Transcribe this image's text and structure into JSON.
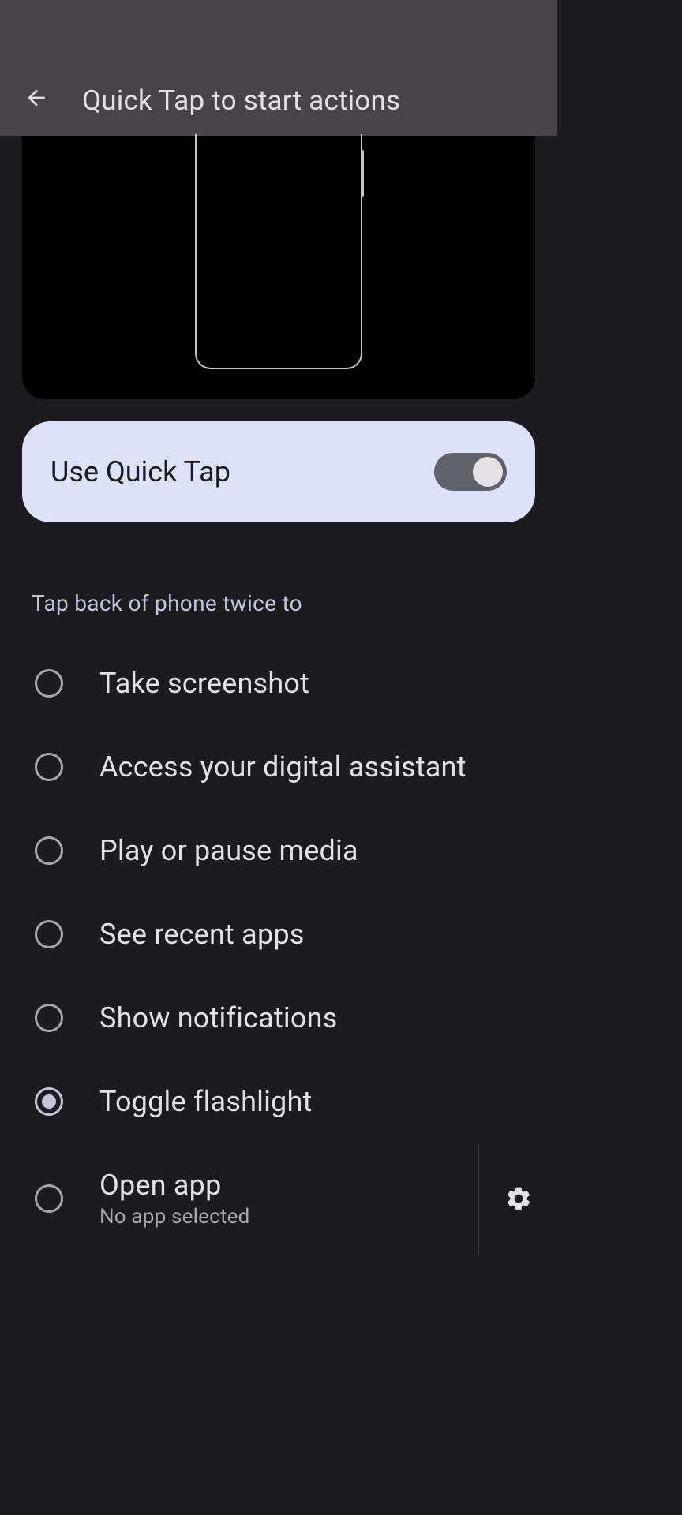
{
  "header": {
    "title": "Quick Tap to start actions"
  },
  "toggle": {
    "label": "Use Quick Tap",
    "enabled": true
  },
  "section_header": "Tap back of phone twice to",
  "radio_options": [
    {
      "label": "Take screenshot",
      "selected": false
    },
    {
      "label": "Access your digital assistant",
      "selected": false
    },
    {
      "label": "Play or pause media",
      "selected": false
    },
    {
      "label": "See recent apps",
      "selected": false
    },
    {
      "label": "Show notifications",
      "selected": false
    },
    {
      "label": "Toggle flashlight",
      "selected": true
    },
    {
      "label": "Open app",
      "sublabel": "No app selected",
      "selected": false,
      "has_settings": true
    }
  ]
}
